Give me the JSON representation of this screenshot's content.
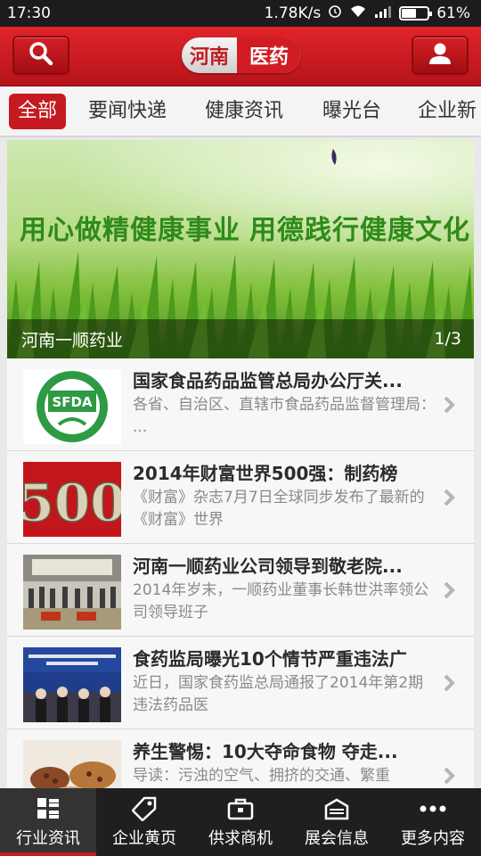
{
  "status": {
    "time": "17:30",
    "speed": "1.78K/s",
    "battery": "61%",
    "battery_level": 0.61
  },
  "header": {
    "logo_left": "河南",
    "logo_right": "医药",
    "colors": {
      "primary": "#c51a21",
      "dark": "#1f1f1f"
    }
  },
  "tabs": [
    {
      "label": "全部",
      "active": true
    },
    {
      "label": "要闻快递"
    },
    {
      "label": "健康资讯"
    },
    {
      "label": "曝光台"
    },
    {
      "label": "企业新"
    }
  ],
  "banner": {
    "slogan_left": "用心做精健康事业",
    "slogan_right": "用德践行健康文化",
    "caption": "河南一顺药业",
    "pager": "1/3"
  },
  "news": [
    {
      "title": "国家食品药品监管总局办公厅关...",
      "summary": "各省、自治区、直辖市食品药品监督管理局： ...",
      "thumb": "SFDA"
    },
    {
      "title": "2014年财富世界500强：制药榜",
      "summary": "《财富》杂志7月7日全球同步发布了最新的《财富》世界",
      "thumb": "500"
    },
    {
      "title": "河南一顺药业公司领导到敬老院...",
      "summary": "2014年岁末，一顺药业董事长韩世洪率领公司领导班子",
      "thumb": ""
    },
    {
      "title": "食药监局曝光10个情节严重违法广",
      "summary": "近日，国家食药监总局通报了2014年第2期违法药品医",
      "thumb": ""
    },
    {
      "title": "养生警惕：10大夺命食物 夺走...",
      "summary": "导读：污浊的空气、拥挤的交通、繁重",
      "thumb": ""
    }
  ],
  "bottom_nav": [
    {
      "label": "行业资讯",
      "icon": "grid-icon",
      "active": true
    },
    {
      "label": "企业黄页",
      "icon": "tag-icon"
    },
    {
      "label": "供求商机",
      "icon": "briefcase-icon"
    },
    {
      "label": "展会信息",
      "icon": "inbox-icon"
    },
    {
      "label": "更多内容",
      "icon": "more-icon"
    }
  ]
}
